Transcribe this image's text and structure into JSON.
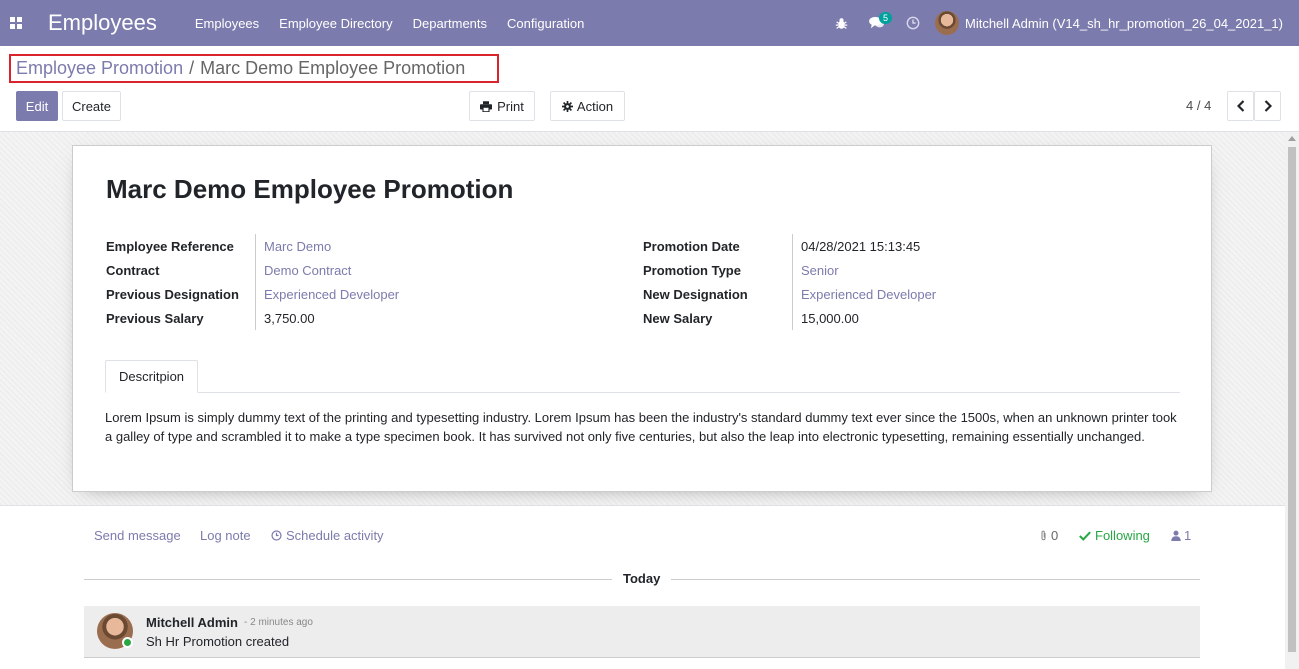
{
  "navbar": {
    "app_title": "Employees",
    "menu": [
      "Employees",
      "Employee Directory",
      "Departments",
      "Configuration"
    ],
    "messages_count": "5",
    "user_name": "Mitchell Admin (V14_sh_hr_promotion_26_04_2021_1)"
  },
  "breadcrumb": {
    "parent": "Employee Promotion",
    "separator": "/",
    "current": "Marc Demo Employee Promotion"
  },
  "toolbar": {
    "edit_label": "Edit",
    "create_label": "Create",
    "print_label": "Print",
    "action_label": "Action",
    "pager": "4 / 4"
  },
  "record": {
    "title": "Marc Demo Employee Promotion",
    "left_fields": [
      {
        "label": "Employee Reference",
        "value": "Marc Demo"
      },
      {
        "label": "Contract",
        "value": "Demo Contract"
      },
      {
        "label": "Previous Designation",
        "value": "Experienced Developer"
      },
      {
        "label": "Previous Salary",
        "value": "3,750.00"
      }
    ],
    "right_fields": [
      {
        "label": "Promotion Date",
        "value": "04/28/2021 15:13:45"
      },
      {
        "label": "Promotion Type",
        "value": "Senior"
      },
      {
        "label": "New Designation",
        "value": "Experienced Developer"
      },
      {
        "label": "New Salary",
        "value": "15,000.00"
      }
    ],
    "tab_label": "Descritpion",
    "description": "Lorem Ipsum is simply dummy text of the printing and typesetting industry. Lorem Ipsum has been the industry's standard dummy text ever since the 1500s, when an unknown printer took a galley of type and scrambled it to make a type specimen book. It has survived not only five centuries, but also the leap into electronic typesetting, remaining essentially unchanged."
  },
  "chatter": {
    "send_message": "Send message",
    "log_note": "Log note",
    "schedule_activity": "Schedule activity",
    "attachments_count": "0",
    "following_label": "Following",
    "followers_count": "1",
    "date_separator": "Today",
    "messages": [
      {
        "author": "Mitchell Admin",
        "time": "- 2 minutes ago",
        "body": "Sh Hr Promotion created"
      }
    ]
  },
  "colors": {
    "brand": "#7c7bad",
    "breadcrumb_highlight": "#d9232d",
    "following": "#28a745"
  }
}
